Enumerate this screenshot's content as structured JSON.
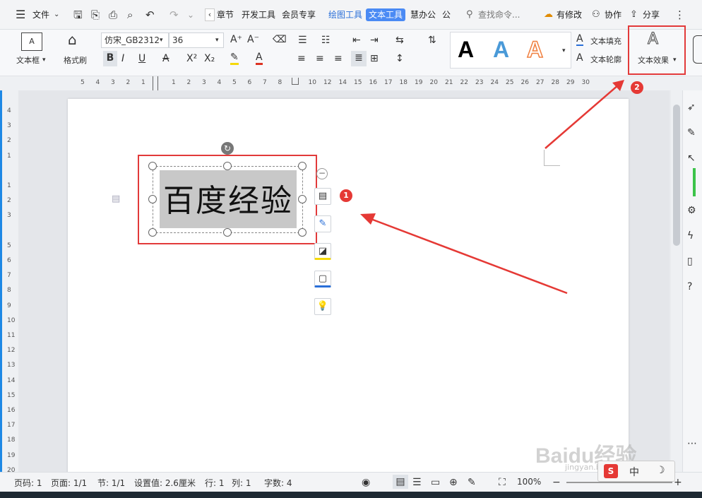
{
  "menu": {
    "file": "文件",
    "tabs": [
      "章节",
      "开发工具",
      "会员专享",
      "绘图工具",
      "文本工具",
      "慧办公",
      "公"
    ],
    "search_placeholder": "查找命令...",
    "modified": "有修改",
    "collab": "协作",
    "share": "分享"
  },
  "ribbon": {
    "textbox": "文本框",
    "format_painter": "格式刷",
    "font_name": "仿宋_GB2312",
    "font_size": "36",
    "styles": [
      "A",
      "A",
      "A"
    ],
    "style_colors": [
      "#000000",
      "#4a9ad8",
      "#f08040"
    ],
    "text_fill": "文本填充",
    "text_outline": "文本轮廓",
    "text_effect": "文本效果"
  },
  "ruler_h": [
    "5",
    "4",
    "3",
    "2",
    "1",
    "",
    "1",
    "2",
    "3",
    "4",
    "5",
    "6",
    "7",
    "8",
    "",
    "10",
    "12",
    "14",
    "15",
    "16",
    "17",
    "18",
    "19",
    "20",
    "21",
    "22",
    "23",
    "24",
    "25",
    "26",
    "27",
    "28",
    "29",
    "30"
  ],
  "ruler_v": [
    "4",
    "3",
    "2",
    "1",
    "",
    "1",
    "2",
    "3",
    "",
    "5",
    "6",
    "7",
    "8",
    "9",
    "10",
    "11",
    "12",
    "13",
    "14",
    "15",
    "16",
    "17",
    "18",
    "19",
    "20"
  ],
  "document": {
    "textbox_text": "百度经验"
  },
  "annotations": {
    "badge1": "1",
    "badge2": "2"
  },
  "status": {
    "page_code": "页码: 1",
    "pages": "页面: 1/1",
    "section": "节: 1/1",
    "setting": "设置值: 2.6厘米",
    "row": "行: 1",
    "col": "列: 1",
    "words": "字数: 4",
    "zoom": "100%",
    "ime": "中"
  },
  "watermark": {
    "brand": "Baidu经验",
    "url": "jingyan.baidu.com"
  },
  "colors": {
    "accent": "#4a8af4",
    "highlight_red": "#e23a3a",
    "text_bg": "#c8c8c8"
  }
}
